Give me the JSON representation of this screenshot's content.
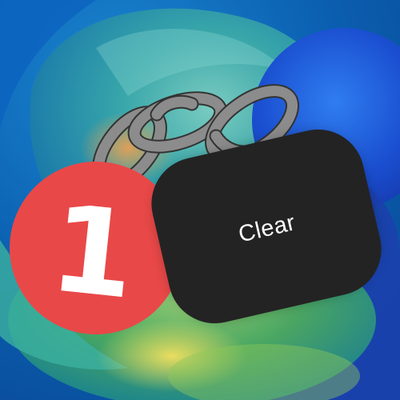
{
  "notification_badge": {
    "count": "1",
    "color": "#e94848"
  },
  "clear_button": {
    "label": "Clear",
    "background": "#232323"
  },
  "chain": {
    "icon": "chain-link-icon",
    "color": "#8c8c8c"
  }
}
